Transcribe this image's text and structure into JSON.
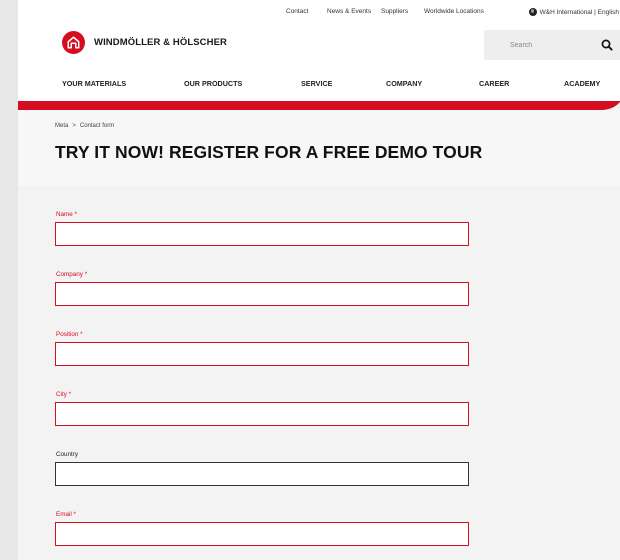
{
  "meta_nav": {
    "contact": "Contact",
    "news": "News & Events",
    "suppliers": "Suppliers",
    "locations": "Worldwide Locations",
    "language": "W&H International | English"
  },
  "logo": {
    "text": "WINDMÖLLER & HÖLSCHER"
  },
  "search": {
    "placeholder": "Search"
  },
  "main_nav": {
    "materials": "YOUR MATERIALS",
    "products": "OUR PRODUCTS",
    "service": "SERVICE",
    "company": "COMPANY",
    "career": "CAREER",
    "academy": "ACADEMY"
  },
  "breadcrumb": {
    "parent": "Meta",
    "separator": ">",
    "current": "Contact form"
  },
  "page_title": "TRY IT NOW! REGISTER FOR A FREE DEMO TOUR",
  "form": {
    "fields": [
      {
        "label": "Name *",
        "value": ""
      },
      {
        "label": "Company *",
        "value": ""
      },
      {
        "label": "Position *",
        "value": ""
      },
      {
        "label": "City *",
        "value": ""
      },
      {
        "label": "Country",
        "value": ""
      },
      {
        "label": "Email *",
        "value": ""
      }
    ]
  },
  "colors": {
    "brand_red": "#d50d20",
    "background": "#f3f3f3"
  }
}
